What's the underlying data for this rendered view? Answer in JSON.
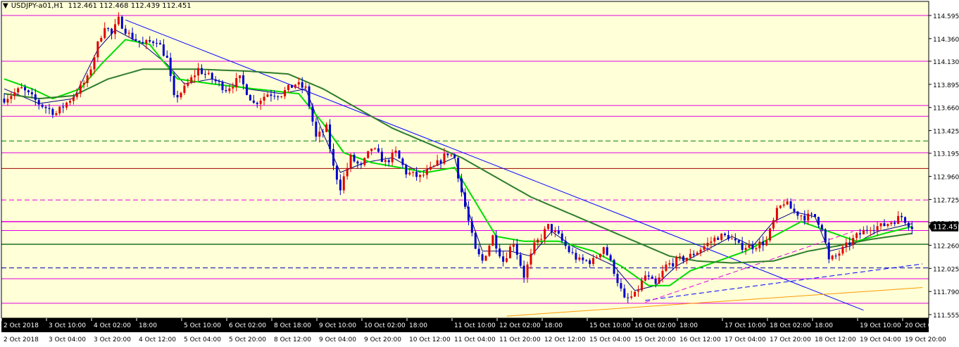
{
  "header": {
    "menu_icon": "triangle-down-icon",
    "symbol_timeframe": "USDJPY-a01,H1",
    "ohlc": "112.461 112.468 112.439 112.451"
  },
  "colors": {
    "background": "#ffffd8",
    "bull_candle": "#e00000",
    "bear_candle": "#0000cc",
    "fast_ma": "#000080",
    "mid_ma": "#00dd00",
    "slow_ma": "#2e7d2e",
    "magenta_level": "#e000e0",
    "red_level": "#990000",
    "green_level": "#008000",
    "blue_level": "#0000aa",
    "dark_green_level": "#2e7d2e",
    "trend_blue": "#0000ff",
    "trend_orange": "#ff9900",
    "trend_magenta": "#e000e0",
    "bottom_bar": "#000000",
    "price_tag": "#000000"
  },
  "chart_data": {
    "type": "candlestick",
    "symbol": "USDJPY-a01",
    "timeframe": "H1",
    "ylim": [
      111.53,
      114.63
    ],
    "y_ticks": [
      "114.595",
      "114.360",
      "114.130",
      "113.895",
      "113.660",
      "113.425",
      "113.195",
      "112.960",
      "112.725",
      "112.490",
      "112.260",
      "112.025",
      "111.790",
      "111.555"
    ],
    "current_price": "112.451",
    "x_labels_top": [
      "2 Oct 2018",
      "3 Oct 10:00",
      "4 Oct 02:00",
      "18:00",
      "5 Oct 10:00",
      "6 Oct 02:00",
      "8 Oct 18:00",
      "9 Oct 10:00",
      "10 Oct 02:00",
      "18:00",
      "11 Oct 10:00",
      "12 Oct 02:00",
      "18:00",
      "15 Oct 10:00",
      "16 Oct 02:00",
      "18:00",
      "17 Oct 10:00",
      "18 Oct 02:00",
      "18:00",
      "19 Oct 10:00",
      "20 Oct 0"
    ],
    "x_labels_bottom": [
      "2 Oct 2018",
      "3 Oct 04:00",
      "3 Oct 20:00",
      "4 Oct 12:00",
      "5 Oct 04:00",
      "5 Oct 20:00",
      "8 Oct 12:00",
      "9 Oct 04:00",
      "9 Oct 20:00",
      "10 Oct 12:00",
      "11 Oct 04:00",
      "11 Oct 20:00",
      "12 Oct 12:00",
      "15 Oct 04:00",
      "15 Oct 20:00",
      "16 Oct 12:00",
      "17 Oct 04:00",
      "17 Oct 20:00",
      "18 Oct 12:00",
      "19 Oct 04:00",
      "19 Oct 20:00"
    ],
    "close_path": [
      [
        0,
        113.75
      ],
      [
        5,
        113.85
      ],
      [
        10,
        113.7
      ],
      [
        15,
        113.6
      ],
      [
        20,
        113.78
      ],
      [
        24,
        113.95
      ],
      [
        27,
        114.3
      ],
      [
        29,
        114.5
      ],
      [
        31,
        114.4
      ],
      [
        33,
        114.55
      ],
      [
        36,
        114.4
      ],
      [
        40,
        114.3
      ],
      [
        44,
        114.35
      ],
      [
        47,
        114.15
      ],
      [
        49,
        113.75
      ],
      [
        52,
        113.85
      ],
      [
        56,
        114.05
      ],
      [
        60,
        113.95
      ],
      [
        64,
        113.85
      ],
      [
        68,
        113.95
      ],
      [
        72,
        113.7
      ],
      [
        76,
        113.8
      ],
      [
        80,
        113.8
      ],
      [
        84,
        113.9
      ],
      [
        87,
        113.85
      ],
      [
        90,
        113.35
      ],
      [
        93,
        113.45
      ],
      [
        95,
        113.05
      ],
      [
        97,
        112.85
      ],
      [
        100,
        113.15
      ],
      [
        103,
        113.05
      ],
      [
        106,
        113.25
      ],
      [
        110,
        113.1
      ],
      [
        113,
        113.2
      ],
      [
        116,
        113.0
      ],
      [
        120,
        112.95
      ],
      [
        124,
        113.05
      ],
      [
        128,
        113.2
      ],
      [
        130,
        113.15
      ],
      [
        132,
        112.8
      ],
      [
        134,
        112.5
      ],
      [
        136,
        112.2
      ],
      [
        138,
        112.1
      ],
      [
        141,
        112.35
      ],
      [
        144,
        112.1
      ],
      [
        147,
        112.3
      ],
      [
        150,
        111.95
      ],
      [
        153,
        112.25
      ],
      [
        157,
        112.45
      ],
      [
        160,
        112.35
      ],
      [
        163,
        112.2
      ],
      [
        166,
        112.1
      ],
      [
        170,
        112.1
      ],
      [
        173,
        112.25
      ],
      [
        176,
        112.0
      ],
      [
        179,
        111.7
      ],
      [
        182,
        111.75
      ],
      [
        185,
        111.95
      ],
      [
        188,
        111.85
      ],
      [
        191,
        112.05
      ],
      [
        194,
        112.1
      ],
      [
        198,
        112.15
      ],
      [
        202,
        112.25
      ],
      [
        206,
        112.35
      ],
      [
        209,
        112.35
      ],
      [
        212,
        112.25
      ],
      [
        216,
        112.25
      ],
      [
        220,
        112.3
      ],
      [
        223,
        112.6
      ],
      [
        225,
        112.7
      ],
      [
        228,
        112.6
      ],
      [
        231,
        112.55
      ],
      [
        234,
        112.55
      ],
      [
        236,
        112.45
      ],
      [
        238,
        112.1
      ],
      [
        240,
        112.15
      ],
      [
        243,
        112.25
      ],
      [
        246,
        112.35
      ],
      [
        250,
        112.45
      ],
      [
        253,
        112.45
      ],
      [
        256,
        112.5
      ],
      [
        259,
        112.55
      ],
      [
        262,
        112.45
      ]
    ],
    "moving_averages": [
      {
        "color_key": "fast_ma",
        "path": [
          [
            0,
            113.85
          ],
          [
            10,
            113.7
          ],
          [
            20,
            113.75
          ],
          [
            27,
            114.25
          ],
          [
            32,
            114.45
          ],
          [
            40,
            114.3
          ],
          [
            47,
            114.1
          ],
          [
            52,
            113.9
          ],
          [
            60,
            113.95
          ],
          [
            70,
            113.85
          ],
          [
            80,
            113.8
          ],
          [
            87,
            113.85
          ],
          [
            92,
            113.4
          ],
          [
            97,
            113.0
          ],
          [
            104,
            113.1
          ],
          [
            112,
            113.15
          ],
          [
            120,
            113.0
          ],
          [
            130,
            113.15
          ],
          [
            134,
            112.6
          ],
          [
            138,
            112.2
          ],
          [
            146,
            112.2
          ],
          [
            152,
            112.15
          ],
          [
            158,
            112.4
          ],
          [
            164,
            112.25
          ],
          [
            170,
            112.15
          ],
          [
            176,
            112.05
          ],
          [
            182,
            111.8
          ],
          [
            188,
            111.85
          ],
          [
            194,
            112.05
          ],
          [
            202,
            112.2
          ],
          [
            210,
            112.35
          ],
          [
            216,
            112.25
          ],
          [
            222,
            112.5
          ],
          [
            228,
            112.6
          ],
          [
            234,
            112.55
          ],
          [
            238,
            112.2
          ],
          [
            244,
            112.25
          ],
          [
            252,
            112.4
          ],
          [
            262,
            112.48
          ]
        ]
      },
      {
        "color_key": "mid_ma",
        "path": [
          [
            0,
            113.95
          ],
          [
            8,
            113.85
          ],
          [
            14,
            113.75
          ],
          [
            22,
            113.85
          ],
          [
            28,
            114.1
          ],
          [
            35,
            114.35
          ],
          [
            42,
            114.3
          ],
          [
            50,
            113.95
          ],
          [
            60,
            113.9
          ],
          [
            72,
            113.85
          ],
          [
            85,
            113.8
          ],
          [
            92,
            113.5
          ],
          [
            98,
            113.2
          ],
          [
            106,
            113.1
          ],
          [
            114,
            113.05
          ],
          [
            122,
            113.0
          ],
          [
            130,
            113.05
          ],
          [
            136,
            112.7
          ],
          [
            142,
            112.35
          ],
          [
            150,
            112.3
          ],
          [
            160,
            112.3
          ],
          [
            170,
            112.2
          ],
          [
            178,
            112.05
          ],
          [
            186,
            111.85
          ],
          [
            192,
            111.85
          ],
          [
            198,
            112.0
          ],
          [
            206,
            112.1
          ],
          [
            214,
            112.2
          ],
          [
            222,
            112.35
          ],
          [
            230,
            112.5
          ],
          [
            238,
            112.4
          ],
          [
            246,
            112.3
          ],
          [
            254,
            112.38
          ],
          [
            262,
            112.45
          ]
        ]
      },
      {
        "color_key": "slow_ma",
        "path": [
          [
            0,
            113.8
          ],
          [
            10,
            113.75
          ],
          [
            20,
            113.78
          ],
          [
            30,
            113.95
          ],
          [
            40,
            114.05
          ],
          [
            55,
            114.05
          ],
          [
            70,
            114.03
          ],
          [
            82,
            114.0
          ],
          [
            92,
            113.85
          ],
          [
            102,
            113.65
          ],
          [
            112,
            113.45
          ],
          [
            122,
            113.3
          ],
          [
            132,
            113.15
          ],
          [
            142,
            112.95
          ],
          [
            152,
            112.75
          ],
          [
            162,
            112.6
          ],
          [
            172,
            112.45
          ],
          [
            182,
            112.3
          ],
          [
            192,
            112.15
          ],
          [
            200,
            112.1
          ],
          [
            210,
            112.08
          ],
          [
            222,
            112.1
          ],
          [
            232,
            112.2
          ],
          [
            240,
            112.25
          ],
          [
            250,
            112.32
          ],
          [
            262,
            112.38
          ]
        ]
      }
    ],
    "horizontal_levels": [
      {
        "price": 114.595,
        "color_key": "magenta_level",
        "style": "solid"
      },
      {
        "price": 114.13,
        "color_key": "magenta_level",
        "style": "solid"
      },
      {
        "price": 113.68,
        "color_key": "magenta_level",
        "style": "solid"
      },
      {
        "price": 113.57,
        "color_key": "magenta_level",
        "style": "solid"
      },
      {
        "price": 113.32,
        "color_key": "green_level",
        "style": "dashed"
      },
      {
        "price": 113.2,
        "color_key": "magenta_level",
        "style": "solid"
      },
      {
        "price": 113.04,
        "color_key": "red_level",
        "style": "solid"
      },
      {
        "price": 112.72,
        "color_key": "magenta_level",
        "style": "dashed"
      },
      {
        "price": 112.5,
        "color_key": "magenta_level",
        "style": "solid-thick"
      },
      {
        "price": 112.41,
        "color_key": "magenta_level",
        "style": "solid"
      },
      {
        "price": 112.27,
        "color_key": "dark_green_level",
        "style": "solid-thick"
      },
      {
        "price": 112.03,
        "color_key": "blue_level",
        "style": "dashed"
      },
      {
        "price": 111.92,
        "color_key": "magenta_level",
        "style": "solid"
      },
      {
        "price": 111.67,
        "color_key": "magenta_level",
        "style": "solid"
      }
    ],
    "trend_lines": [
      {
        "color_key": "trend_blue",
        "style": "solid",
        "from": [
          35,
          114.55
        ],
        "to": [
          248,
          111.6
        ]
      },
      {
        "color_key": "trend_blue",
        "style": "dashed",
        "from": [
          185,
          111.7
        ],
        "to": [
          265,
          112.07
        ]
      },
      {
        "color_key": "trend_magenta",
        "style": "dashed",
        "from": [
          185,
          111.68
        ],
        "to": [
          245,
          112.4
        ]
      },
      {
        "color_key": "trend_orange",
        "style": "solid",
        "from": [
          145,
          111.54
        ],
        "to": [
          265,
          111.83
        ]
      }
    ]
  }
}
